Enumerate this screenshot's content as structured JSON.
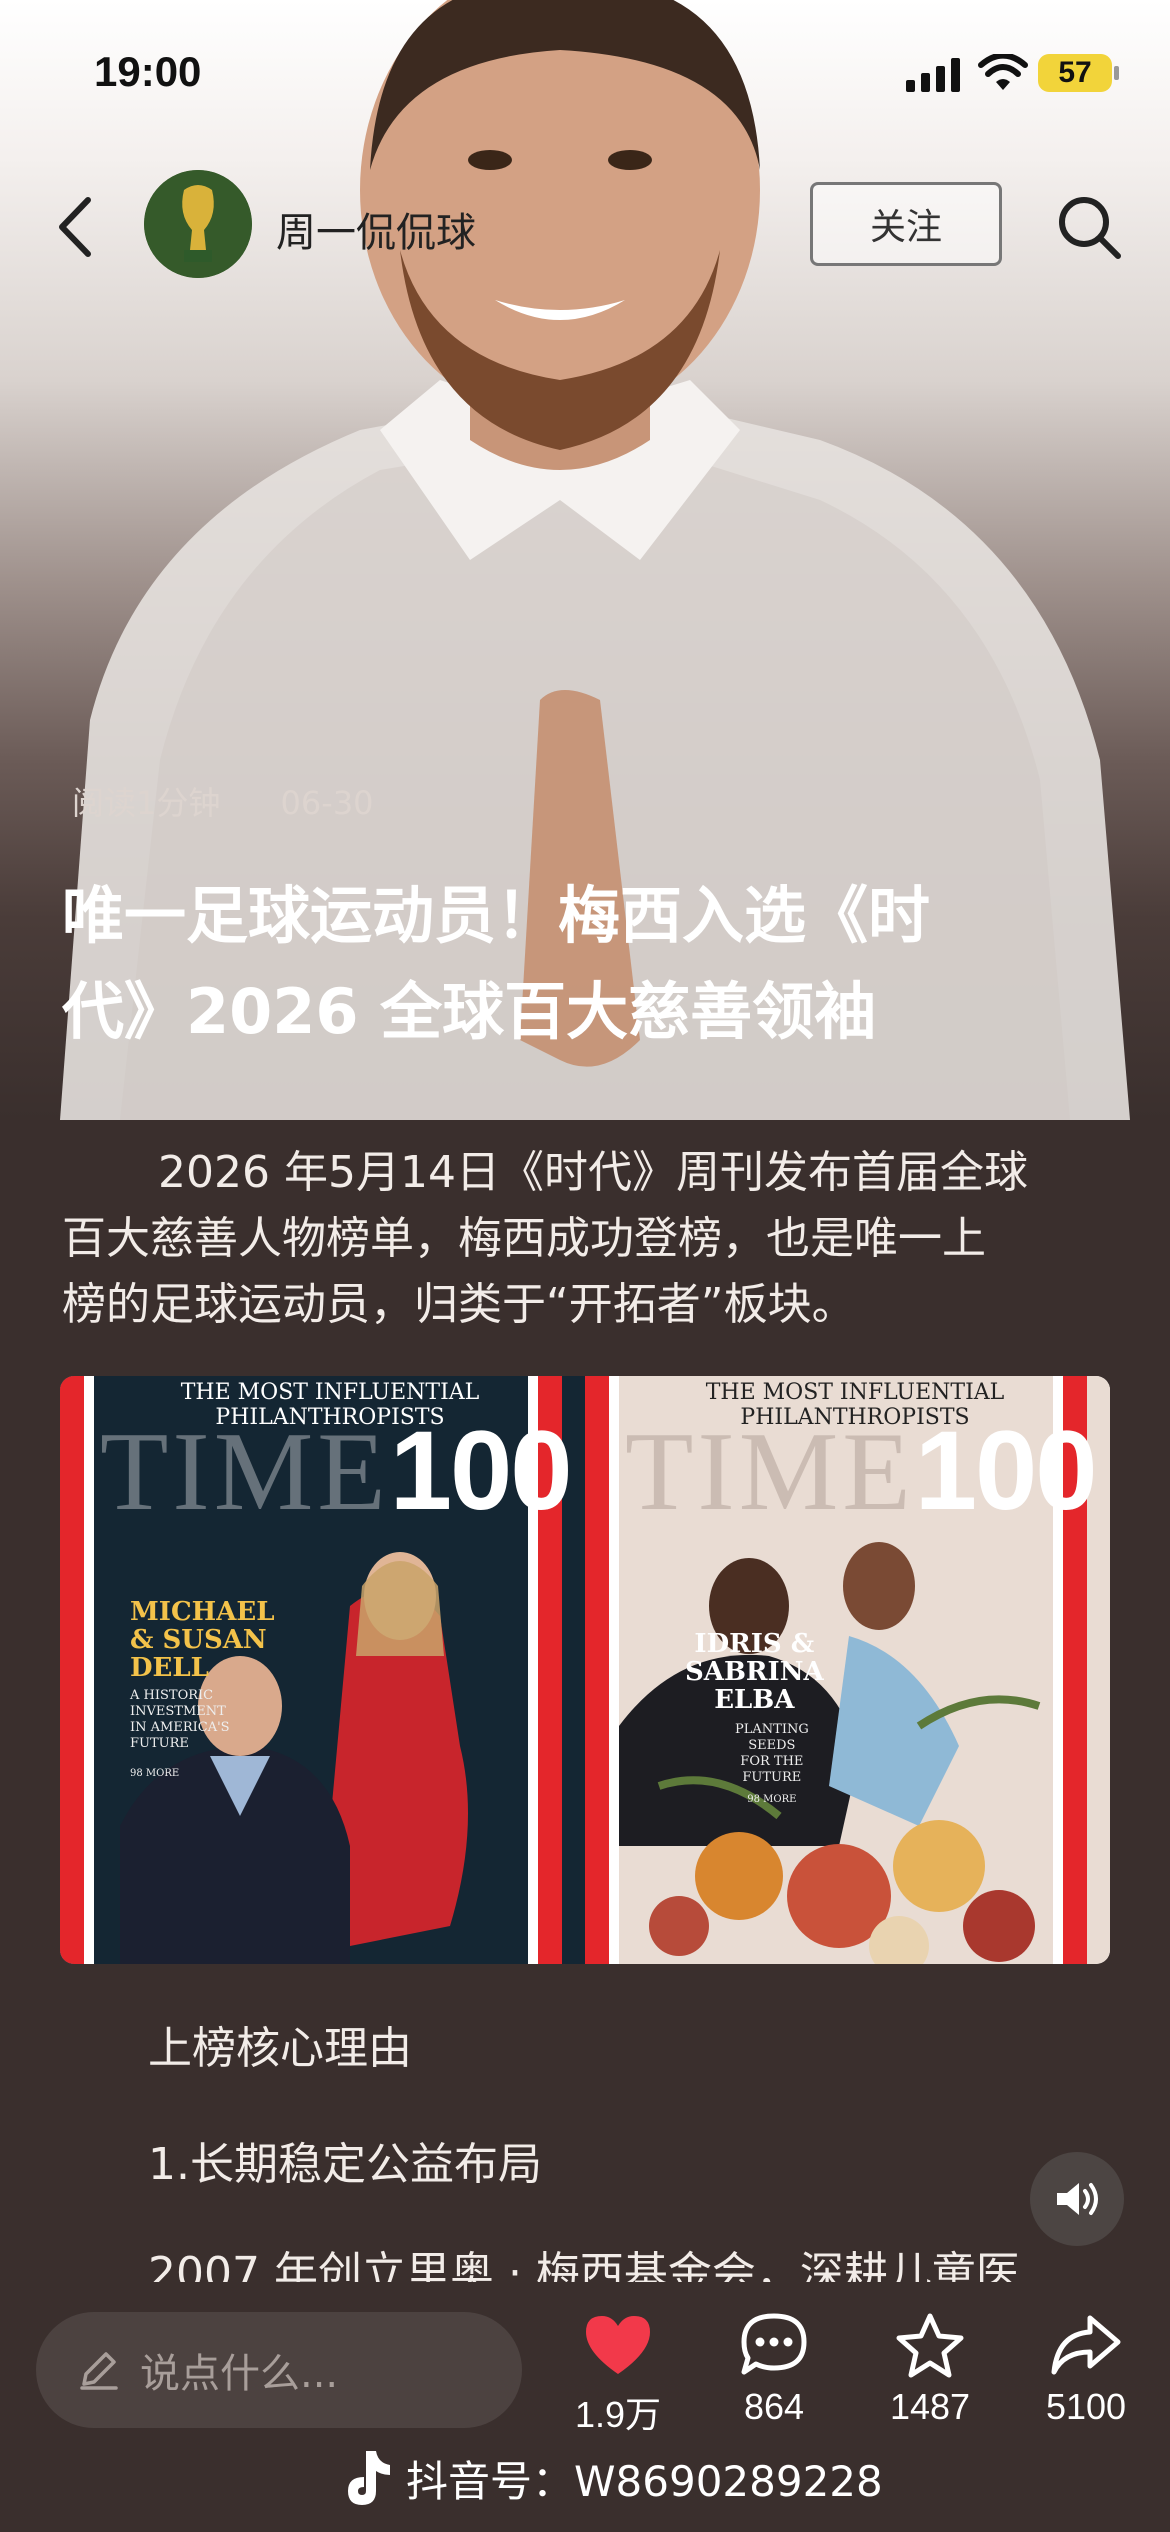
{
  "status": {
    "time": "19:00",
    "battery": "57"
  },
  "nav": {
    "author": "周一侃侃球",
    "follow_label": "关注"
  },
  "article": {
    "read_time": "阅读1分钟",
    "date": "06-30",
    "title_line1": "唯一足球运动员！梅西入选《时",
    "title_line2": "代》2026 全球百大慈善领袖",
    "para_line1": "2026 年5月14日《时代》周刊发布首届全球",
    "para_line2": "百大慈善人物榜单，梅西成功登榜，也是唯一上",
    "para_line3": "榜的足球运动员，归类于“开拓者”板块。",
    "section_heading": "上榜核心理由",
    "point1": "1.长期稳定公益布局",
    "cut_line": "2007 年创立里奥 · 梅西基金会，深耕儿童医"
  },
  "covers": [
    {
      "top_line": "THE MOST INFLUENTIAL PHILANTHROPISTS",
      "logo_word": "TIME",
      "logo_num": "100",
      "name_line1": "MICHAEL",
      "name_line2": "& SUSAN",
      "name_line3": "DELL",
      "sub_line1": "A HISTORIC",
      "sub_line2": "INVESTMENT",
      "sub_line3": "IN AMERICA'S",
      "sub_line4": "FUTURE",
      "more": "98 MORE"
    },
    {
      "top_line": "THE MOST INFLUENTIAL PHILANTHROPISTS",
      "logo_word": "TIME",
      "logo_num": "100",
      "name_line1": "IDRIS &",
      "name_line2": "SABRINA",
      "name_line3": "ELBA",
      "sub_line1": "PLANTING",
      "sub_line2": "SEEDS",
      "sub_line3": "FOR THE",
      "sub_line4": "FUTURE",
      "more": "98 MORE"
    }
  ],
  "bottom": {
    "comment_placeholder": "说点什么...",
    "likes": "1.9万",
    "comments": "864",
    "favorites": "1487",
    "shares": "5100",
    "watermark": "抖音号：W8690289228"
  },
  "colors": {
    "like_red": "#f2394a",
    "background": "#3a2f2d",
    "battery": "#f2d43a"
  },
  "icons": [
    "back-icon",
    "search-icon",
    "sound-icon",
    "pencil-icon",
    "heart-icon",
    "comment-icon",
    "star-icon",
    "share-icon",
    "douyin-logo-icon"
  ]
}
